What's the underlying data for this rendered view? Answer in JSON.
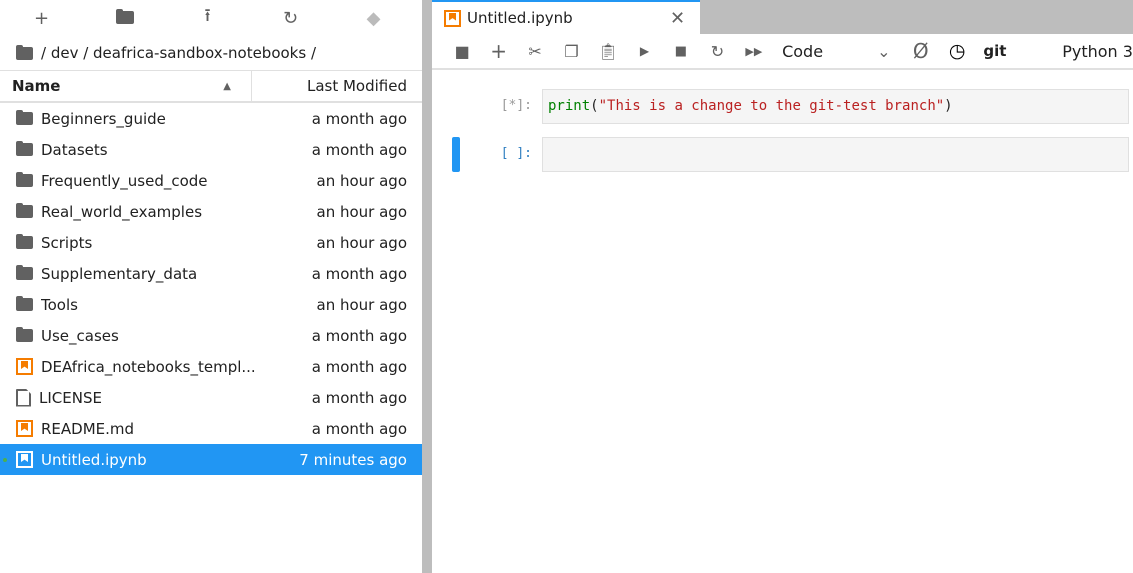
{
  "filebrowser": {
    "toolbar": [
      "new-launcher",
      "new-folder",
      "upload",
      "refresh",
      "git-clone"
    ],
    "breadcrumb": "/ dev / deafrica-sandbox-notebooks /",
    "headers": {
      "name": "Name",
      "modified": "Last Modified"
    },
    "items": [
      {
        "name": "Beginners_guide",
        "modified": "a month ago",
        "type": "folder"
      },
      {
        "name": "Datasets",
        "modified": "a month ago",
        "type": "folder"
      },
      {
        "name": "Frequently_used_code",
        "modified": "an hour ago",
        "type": "folder"
      },
      {
        "name": "Real_world_examples",
        "modified": "an hour ago",
        "type": "folder"
      },
      {
        "name": "Scripts",
        "modified": "an hour ago",
        "type": "folder"
      },
      {
        "name": "Supplementary_data",
        "modified": "a month ago",
        "type": "folder"
      },
      {
        "name": "Tools",
        "modified": "an hour ago",
        "type": "folder"
      },
      {
        "name": "Use_cases",
        "modified": "a month ago",
        "type": "folder"
      },
      {
        "name": "DEAfrica_notebooks_templ...",
        "modified": "a month ago",
        "type": "notebook"
      },
      {
        "name": "LICENSE",
        "modified": "a month ago",
        "type": "file"
      },
      {
        "name": "README.md",
        "modified": "a month ago",
        "type": "notebook"
      },
      {
        "name": "Untitled.ipynb",
        "modified": "7 minutes ago",
        "type": "notebook",
        "selected": true
      }
    ]
  },
  "notebook": {
    "tab_title": "Untitled.ipynb",
    "cell_type": "Code",
    "git_label": "git",
    "kernel": "Python 3",
    "cells": [
      {
        "prompt": "[*]:",
        "code_fn": "print",
        "code_open": "(",
        "code_str": "\"This is a change to the git-test branch\"",
        "code_close": ")"
      },
      {
        "prompt": "[ ]:"
      }
    ]
  },
  "colors": {
    "accent": "#2196f3",
    "notebook_icon": "#f57c00"
  }
}
